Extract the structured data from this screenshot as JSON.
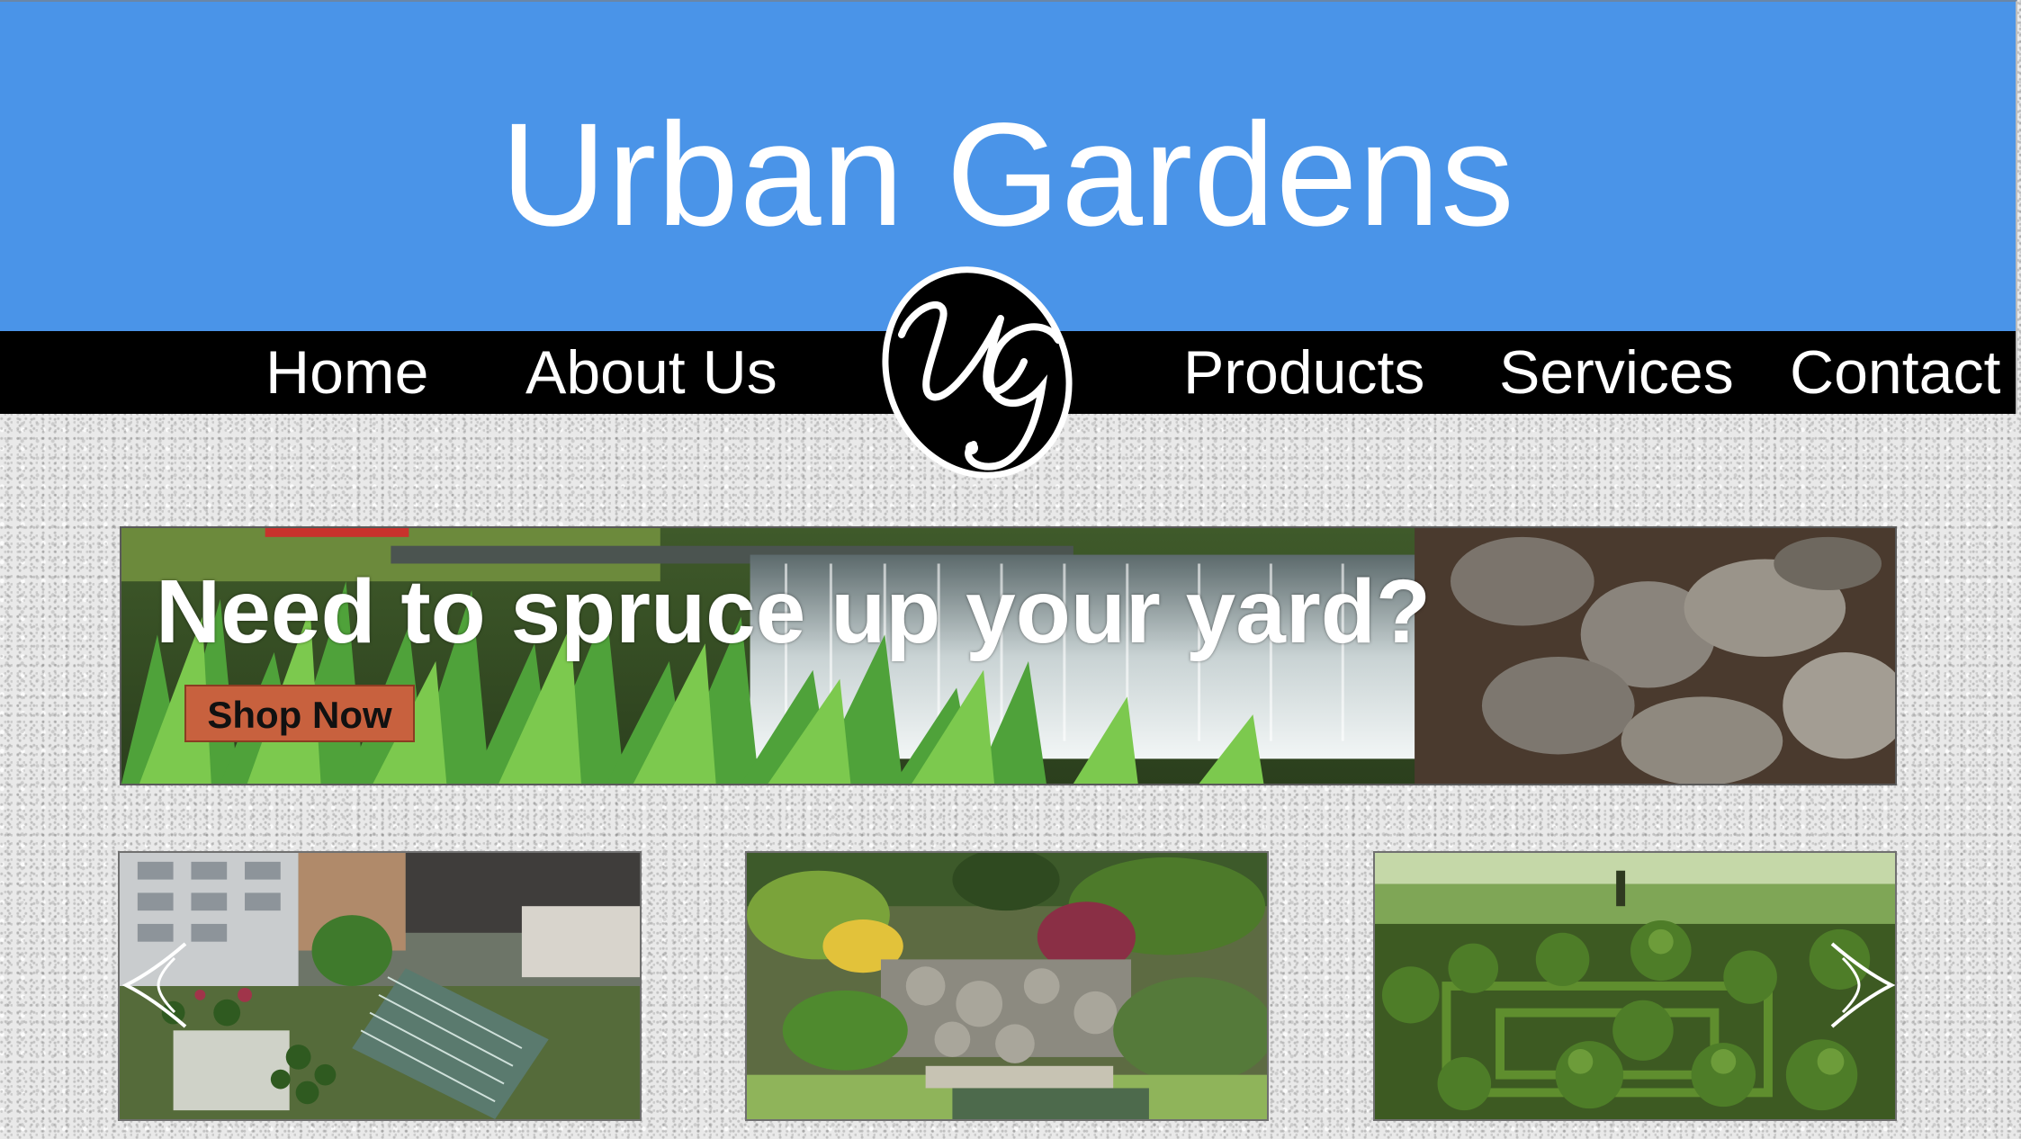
{
  "site": {
    "title": "Urban Gardens",
    "logo_icon": "ug-monogram-logo",
    "logo_monogram": "UG"
  },
  "nav": {
    "items": [
      {
        "label": "Home"
      },
      {
        "label": "About Us"
      },
      {
        "label": "Products"
      },
      {
        "label": "Services"
      },
      {
        "label": "Contact"
      }
    ]
  },
  "hero": {
    "headline": "Need to spruce up your yard?",
    "cta_label": "Shop Now",
    "image": "waterfall-garden-image"
  },
  "gallery": {
    "images": [
      {
        "name": "rooftop-garden-image"
      },
      {
        "name": "rock-garden-image"
      },
      {
        "name": "topiary-garden-image"
      }
    ],
    "prev_icon": "chevron-left-icon",
    "next_icon": "chevron-right-icon"
  },
  "colors": {
    "header_blue": "#4a94e8",
    "nav_black": "#000000",
    "cta_orange": "#c8613e",
    "text_white": "#ffffff"
  }
}
